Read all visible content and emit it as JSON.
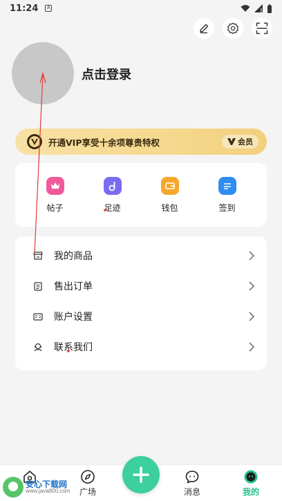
{
  "status": {
    "time": "11:24",
    "badge": "A"
  },
  "profile": {
    "login_text": "点击登录"
  },
  "vip": {
    "text": "开通VIP享受十余项尊贵特权",
    "member_label": "会员"
  },
  "quick_actions": [
    {
      "label": "帖子",
      "icon": "crown-icon",
      "color": "#f05a9a"
    },
    {
      "label": "足迹",
      "icon": "music-note-icon",
      "color": "#7a6cf0"
    },
    {
      "label": "钱包",
      "icon": "wallet-icon",
      "color": "#f7a72b"
    },
    {
      "label": "签到",
      "icon": "checkin-icon",
      "color": "#2f8cf0"
    }
  ],
  "menu": [
    {
      "label": "我的商品",
      "icon": "store-icon"
    },
    {
      "label": "售出订单",
      "icon": "order-list-icon"
    },
    {
      "label": "账户设置",
      "icon": "account-card-icon"
    },
    {
      "label": "联系我们",
      "icon": "support-icon"
    }
  ],
  "tabs": [
    {
      "label": "广场",
      "icon": "compass-icon"
    },
    {
      "label": "消息",
      "icon": "chat-bubble-icon"
    },
    {
      "label": "我的",
      "icon": "smiley-icon",
      "active": true
    }
  ],
  "watermark": {
    "title": "安心下载网",
    "url": "www.java800.com"
  },
  "colors": {
    "accent": "#3ccf9f",
    "active_tab": "#27c08c",
    "vip_gold": "#f5d98e",
    "annotation_red": "#e53935"
  }
}
